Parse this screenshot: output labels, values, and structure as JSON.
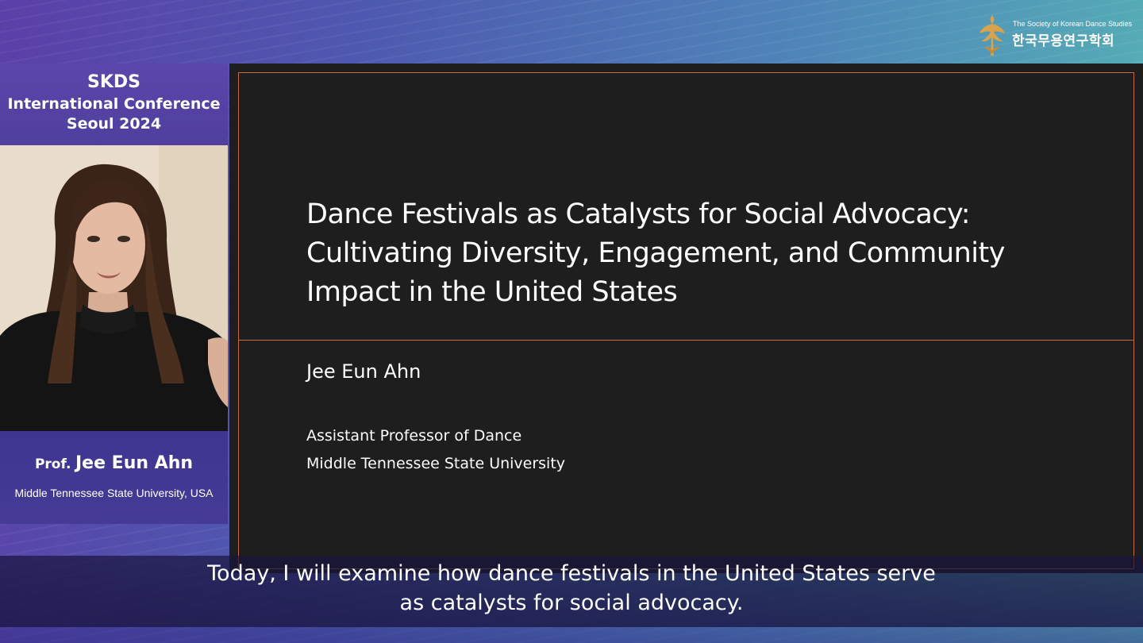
{
  "society": {
    "name_en": "The Society of Korean Dance Studies",
    "name_ko": "한국무용연구학회",
    "logo_icon": "dancer-emblem-icon"
  },
  "conference": {
    "line1": "SKDS",
    "line2": "International Conference",
    "line3": "Seoul 2024"
  },
  "speaker": {
    "prefix": "Prof.",
    "name": "Jee Eun Ahn",
    "affiliation": "Middle Tennessee State University, USA"
  },
  "slide": {
    "title_lines": [
      "Dance Festivals as Catalysts for Social Advocacy:",
      "Cultivating Diversity, Engagement, and Community",
      "Impact in the United States"
    ],
    "author": "Jee Eun Ahn",
    "role": "Assistant Professor of Dance",
    "university": "Middle Tennessee State University",
    "accent_color": "#c76a3b",
    "background_color": "#1e1e1e"
  },
  "subtitle": {
    "lines": [
      "Today, I will examine how dance festivals in the United States serve",
      "as catalysts for social advocacy."
    ]
  },
  "colors": {
    "panel_purple": "#4f3f9e",
    "backdrop_left": "#5b3fa8",
    "backdrop_right": "#57b7b5"
  }
}
